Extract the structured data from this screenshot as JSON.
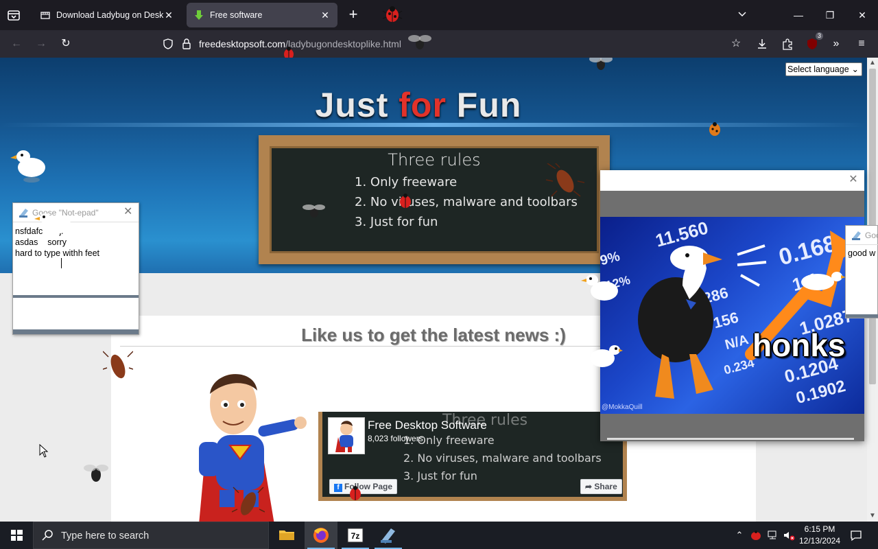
{
  "browser": {
    "tabs": [
      {
        "title": "Download Ladybug on Desktop",
        "active": false
      },
      {
        "title": "Free software",
        "active": true
      }
    ],
    "url_domain": "freedesktopsoft.com",
    "url_path": "/ladybugondesktoplike.html",
    "extension_badge": "3"
  },
  "page": {
    "title_part1": "Just ",
    "title_accent": "for",
    "title_part2": " Fun",
    "language_select": "Select language",
    "board_heading": "Three rules",
    "rules": [
      "1. Only freeware",
      "2. No viruses, malware and toolbars",
      "3. Just for fun"
    ],
    "like_heading": "Like us to get the latest news :)",
    "fb_name": "Free Desktop Software",
    "fb_followers": "8,023 followers",
    "fb_follow": "Follow Page",
    "fb_share": "Share",
    "fb_ghost_heading": "Three rules",
    "fb_ghost_rules": [
      "1. Only freeware",
      "2. No viruses, malware and toolbars",
      "3. Just for fun"
    ]
  },
  "popup": {
    "meme_text": "honks",
    "watermark": "@MokkaQuill",
    "ticker_numbers": [
      "11.560",
      "0.168",
      "9%",
      "12%",
      "286",
      "156",
      "1.0287",
      "N/A",
      "0.234",
      "0.1204",
      "0.1902",
      "1.4"
    ]
  },
  "notepad": {
    "title": "Goose \"Not-epad\"",
    "lines": [
      "nsfdafc       jl",
      "asdas    sorry",
      "hard to type withh feet"
    ]
  },
  "goose_note": {
    "title": "Goo",
    "text": "good w"
  },
  "taskbar": {
    "search_placeholder": "Type here to search",
    "time": "6:15 PM",
    "date": "12/13/2024"
  },
  "colors": {
    "accent_red": "#e2322a",
    "chalkboard": "#1e2624",
    "frame": "#b1834f",
    "firefox_active_tab": "#42414d"
  }
}
